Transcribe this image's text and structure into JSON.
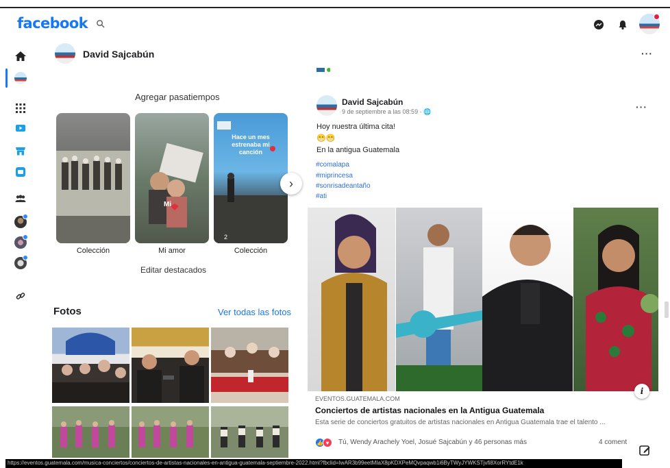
{
  "header": {
    "logo": "facebook",
    "icons": [
      "search-icon",
      "messenger-icon",
      "notifications-icon",
      "account-avatar"
    ]
  },
  "rail": {
    "icons": [
      "home-icon",
      "profile-icon",
      "menu-grid-icon",
      "watch-icon",
      "marketplace-icon",
      "gaming-icon",
      "groups-icon",
      "group-1",
      "group-2",
      "group-3",
      "link-icon"
    ]
  },
  "profile": {
    "name": "David Sajcabún",
    "more": "···"
  },
  "hobbies": {
    "title": "Agregar pasatiempos",
    "highlights": [
      {
        "label": "Colección",
        "overlay": ""
      },
      {
        "label": "Mi amor",
        "overlay": "Mi"
      },
      {
        "label": "Colección",
        "overlay": "Hace un mes estrenaba mi canción",
        "count": "2"
      }
    ],
    "edit": "Editar destacados"
  },
  "photos": {
    "title": "Fotos",
    "see_all": "Ver todas las fotos"
  },
  "post": {
    "author": "David Sajcabún",
    "meta": "9 de septiembre a las 08:59 · 🌐",
    "more": "···",
    "lines": [
      "Hoy nuestra última cita!",
      "😁😁",
      "En la antigua Guatemala"
    ],
    "hashtags": [
      "#comalapa",
      "#miprincesa",
      "#sonrisadeantaño",
      "#ati"
    ],
    "link": {
      "domain": "EVENTOS.GUATEMALA.COM",
      "title": "Conciertos de artistas nacionales en la Antigua Guatemala",
      "description": "Esta serie de conciertos gratuitos de artistas nacionales en Antigua Guatemala trae el talento ..."
    },
    "reactions_text": "Tú, Wendy Arachely Yoel, Josué Sajcabún y 46 personas más",
    "comments": "4 coment"
  },
  "status_url": "https://eventos.guatemala.com/musica-conciertos/conciertos-de-artistas-nacionales-en-antigua-guatemala-septiembre-2022.html?fbclid=IwAR3b99eetMIaX8pKDXPeMQvpaqwb1i6ByTWyJYWKSTjvfi8XorRYtdE1k",
  "colors": {
    "brand": "#1877f2",
    "link": "#2d6fd8"
  }
}
